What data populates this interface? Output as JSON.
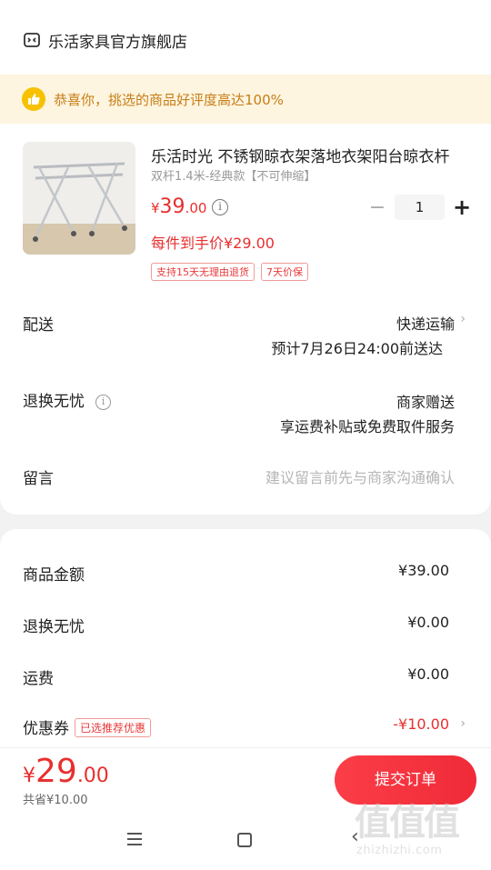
{
  "shop": {
    "name": "乐活家具官方旗舰店"
  },
  "banner": {
    "text": "恭喜你，挑选的商品好评度高达100%"
  },
  "product": {
    "title": "乐活时光  不锈钢晾衣架落地衣架阳台晾衣杆",
    "spec": "双杆1.4米-经典款【不可伸缩】",
    "price_currency": "¥",
    "price_int": "39",
    "price_dec": ".00",
    "info_symbol": "i",
    "minus": "−",
    "quantity": "1",
    "plus": "+",
    "unit_price": "每件到手价¥29.00",
    "tags": [
      "支持15天无理由退货",
      "7天价保"
    ]
  },
  "delivery": {
    "label": "配送",
    "method": "快递运输",
    "eta": "预计7月26日24:00前送达",
    "chevron": "›"
  },
  "returns": {
    "label": "退换无忧",
    "info_symbol": "i",
    "line1": "商家赠送",
    "line2": "享运费补贴或免费取件服务"
  },
  "message": {
    "label": "留言",
    "placeholder": "建议留言前先与商家沟通确认"
  },
  "summary": {
    "goods_label": "商品金额",
    "goods_value": "¥39.00",
    "returns_label": "退换无忧",
    "returns_value": "¥0.00",
    "shipping_label": "运费",
    "shipping_value": "¥0.00",
    "coupon_label": "优惠券",
    "coupon_tag": "已选推荐优惠",
    "coupon_value": "-¥10.00",
    "chevron": "›"
  },
  "footer": {
    "total_currency": "¥",
    "total_int": "29",
    "total_dec": ".00",
    "saved": "共省¥10.00",
    "submit_label": "提交订单"
  },
  "nav": {
    "back_symbol": "‹"
  },
  "watermark": {
    "chars": "值值值",
    "url": "zhizhizhi.com"
  },
  "colors": {
    "price_red": "#e82f2f",
    "banner_bg": "#fdf5df",
    "banner_text": "#c87d18",
    "submit_red": "#f02a38"
  }
}
